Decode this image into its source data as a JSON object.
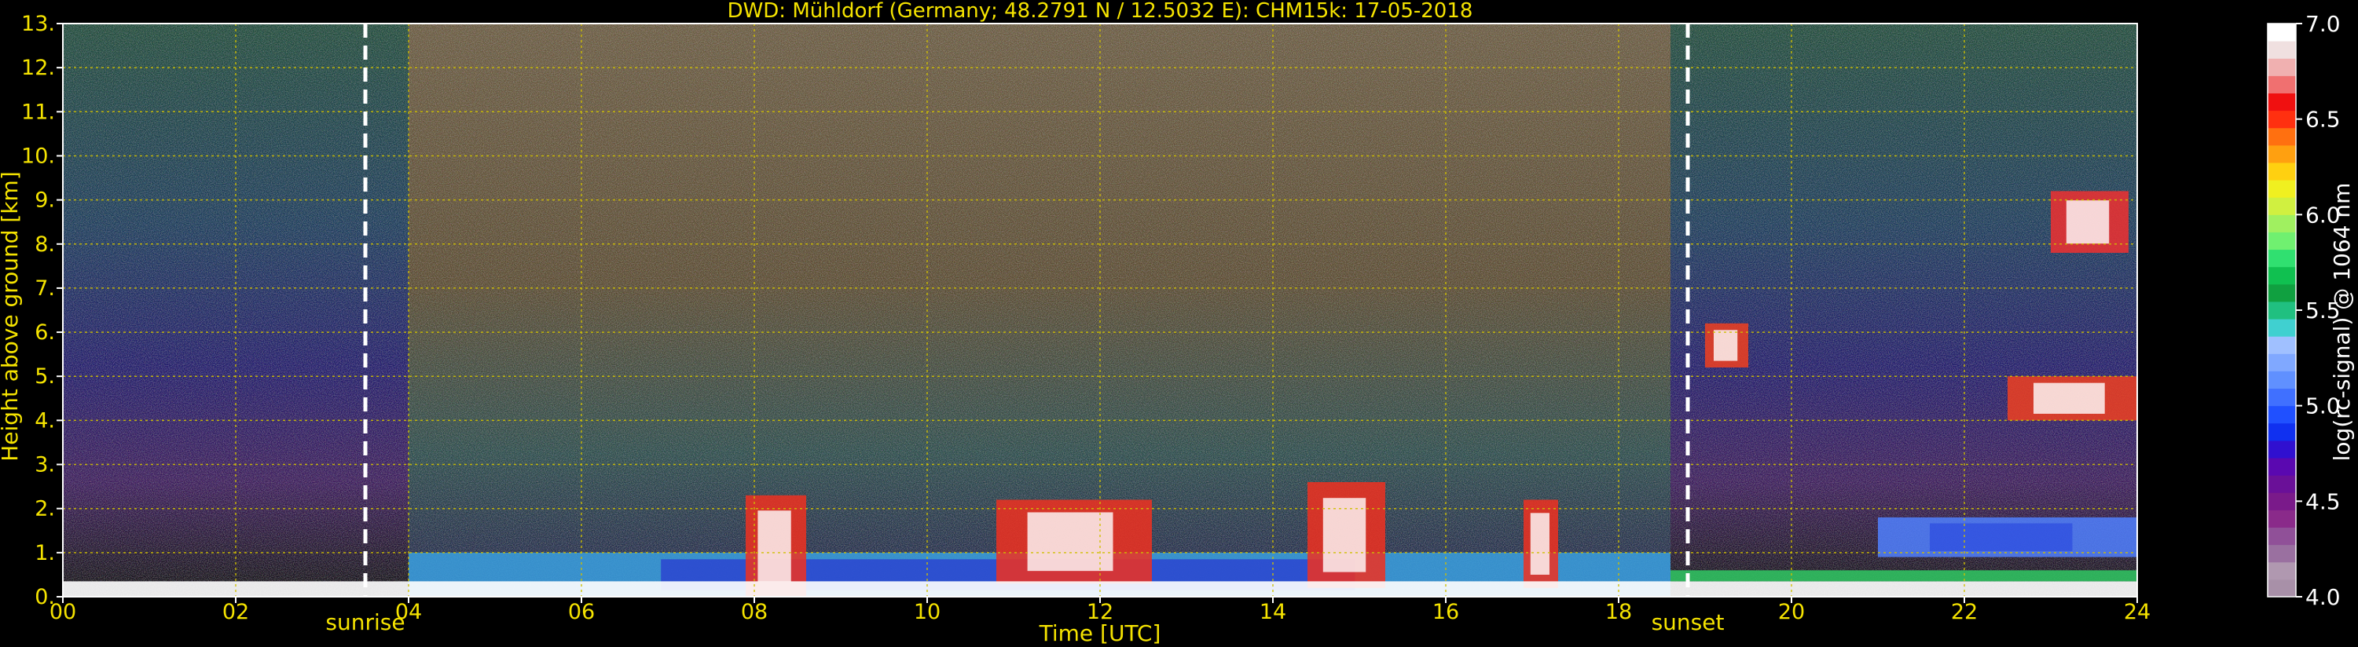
{
  "chart_data": {
    "type": "heatmap",
    "title": "DWD: Mühldorf (Germany; 48.2791 N / 12.5032 E):    CHM15k: 17-05-2018",
    "xlabel": "Time [UTC]",
    "ylabel": "Height above ground [km]",
    "xlim": [
      0,
      24
    ],
    "ylim": [
      0,
      13
    ],
    "x_ticks": [
      "00",
      "02",
      "04",
      "06",
      "08",
      "10",
      "12",
      "14",
      "16",
      "18",
      "20",
      "22",
      "24"
    ],
    "y_ticks": [
      "0.",
      "1.",
      "2.",
      "3.",
      "4.",
      "5.",
      "6.",
      "7.",
      "8.",
      "9.",
      "10.",
      "11.",
      "12.",
      "13."
    ],
    "grid": true,
    "markers": [
      {
        "label": "sunrise",
        "x": 3.5
      },
      {
        "label": "sunset",
        "x": 18.8
      }
    ],
    "colorbar": {
      "label": "log(rc-signal) @ 1064 nm",
      "range": [
        4.0,
        7.0
      ],
      "ticks": [
        "4.0",
        "4.5",
        "5.0",
        "5.5",
        "6.0",
        "6.5",
        "7.0"
      ],
      "colors": [
        "#a890a8",
        "#b098b0",
        "#9a70a0",
        "#905098",
        "#8a2a8a",
        "#7a1a8a",
        "#6a1098",
        "#5a08b0",
        "#3010d0",
        "#1030f0",
        "#2050ff",
        "#4070ff",
        "#6090ff",
        "#80a8ff",
        "#a0c0ff",
        "#40d0d0",
        "#20c080",
        "#10a040",
        "#10c050",
        "#30e070",
        "#70f070",
        "#a0f060",
        "#d0f040",
        "#f0f020",
        "#ffd010",
        "#ffa010",
        "#ff7010",
        "#ff3010",
        "#f01010",
        "#f07070",
        "#f0b0b0",
        "#f0e0e0",
        "#ffffff"
      ]
    },
    "regions": [
      {
        "name": "background-noise-low",
        "x": [
          0,
          24
        ],
        "y": [
          0,
          13
        ]
      },
      {
        "name": "boundary-layer-aerosol",
        "x": [
          4,
          18.6
        ],
        "y": [
          0,
          1.0
        ]
      },
      {
        "name": "convective-cloud",
        "x": [
          7.9,
          8.6
        ],
        "y": [
          0,
          2.3
        ]
      },
      {
        "name": "convective-cloud",
        "x": [
          10.8,
          12.6
        ],
        "y": [
          0.3,
          2.2
        ]
      },
      {
        "name": "convective-cloud",
        "x": [
          14.4,
          15.3
        ],
        "y": [
          0.2,
          2.6
        ]
      },
      {
        "name": "convective-cloud",
        "x": [
          16.9,
          17.3
        ],
        "y": [
          0.2,
          2.2
        ]
      },
      {
        "name": "mid-level-cloud",
        "x": [
          19.0,
          19.5
        ],
        "y": [
          5.2,
          6.2
        ]
      },
      {
        "name": "mid-level-cloud",
        "x": [
          22.5,
          24
        ],
        "y": [
          4.0,
          5.0
        ]
      },
      {
        "name": "cirrus",
        "x": [
          23.0,
          23.9
        ],
        "y": [
          7.8,
          9.2
        ]
      },
      {
        "name": "night-nocturnal-layer",
        "x": [
          21.0,
          24
        ],
        "y": [
          0.9,
          1.8
        ]
      }
    ]
  }
}
